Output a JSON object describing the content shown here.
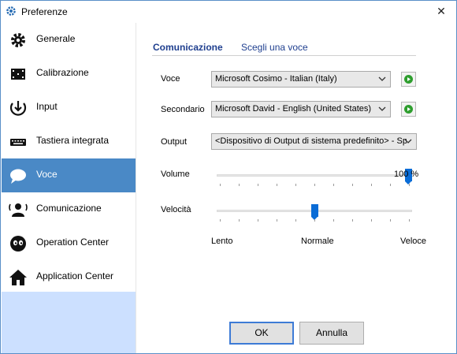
{
  "window": {
    "title": "Preferenze",
    "close_glyph": "✕"
  },
  "sidebar": {
    "items": [
      {
        "label": "Generale",
        "icon": "gear-icon"
      },
      {
        "label": "Calibrazione",
        "icon": "calibration-icon"
      },
      {
        "label": "Input",
        "icon": "input-icon"
      },
      {
        "label": "Tastiera integrata",
        "icon": "keyboard-icon"
      },
      {
        "label": "Voce",
        "icon": "speech-bubble-icon",
        "active": true
      },
      {
        "label": "Comunicazione",
        "icon": "communication-icon"
      },
      {
        "label": "Operation Center",
        "icon": "eyes-icon"
      },
      {
        "label": "Application Center",
        "icon": "home-icon"
      }
    ]
  },
  "tabs": [
    {
      "label": "Comunicazione",
      "active": true
    },
    {
      "label": "Scegli una voce",
      "active": false
    }
  ],
  "form": {
    "voce": {
      "label": "Voce",
      "value": "Microsoft Cosimo - Italian (Italy)"
    },
    "secondario": {
      "label": "Secondario",
      "value": "Microsoft David - English (United States)"
    },
    "output": {
      "label": "Output",
      "value": "<Dispositivo di Output di sistema predefinito> - Speakers"
    },
    "volume": {
      "label": "Volume",
      "value_percent": 100,
      "display": "100 %"
    },
    "velocita": {
      "label": "Velocità",
      "level": 0.5
    },
    "speed_scale": {
      "min": "Lento",
      "mid": "Normale",
      "max": "Veloce"
    }
  },
  "buttons": {
    "ok": "OK",
    "cancel": "Annulla"
  },
  "colors": {
    "accent": "#4a89c6",
    "slider": "#0a6cd6",
    "play": "#2e9e2e",
    "sidebar_bottom": "#cce0ff"
  }
}
